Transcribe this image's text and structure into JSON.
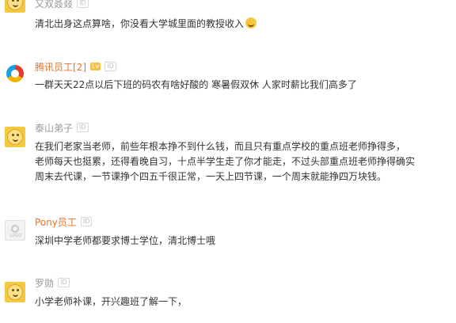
{
  "comments": [
    {
      "username": "又双叒叕",
      "id_badge": "ID",
      "avatar": "smiley-avatar-icon",
      "text": [
        "清北出身这点算啥，你没看大学城里面的教授收入"
      ],
      "emoji": "laughing-tears-emoji"
    },
    {
      "username": "腾讯员工[2]",
      "level_badge": "Lv",
      "id_badge": "ID",
      "avatar": "circle-logo-avatar-icon",
      "text": [
        "一群天天22点以后下班的码农有啥好酸的 寒暑假双休 人家时薪比我们高多了"
      ]
    },
    {
      "username": "泰山弟子",
      "id_badge": "ID",
      "avatar": "smiley-avatar-icon",
      "text": [
        "在我们老家当老师，前些年根本挣不到什么钱，而且只有重点学校的重点班老师挣得多，",
        "老师每天也挺累，还得看晚自习，十点半学生走了你才能走，不过头部重点班老师挣得确实",
        "周末去代课，一节课挣个四五千很正常，一天上四节课，一个周末就能挣四万块钱。"
      ]
    },
    {
      "username": "Pony员工",
      "id_badge": "ID",
      "avatar": "gray-placeholder-avatar-icon",
      "avatar_text": "LOGO",
      "text": [
        "深圳中学老师都要求博士学位，清北博士哦"
      ]
    },
    {
      "username": "罗勋",
      "id_badge": "ID",
      "avatar": "smiley-avatar-icon",
      "text": [
        "小学老师补课，开兴趣班了解一下，"
      ]
    }
  ],
  "colors": {
    "username_default": "#999999",
    "username_highlight": "#e8752c",
    "body_text": "#333333",
    "avatar_yellow": "#f5c842"
  }
}
